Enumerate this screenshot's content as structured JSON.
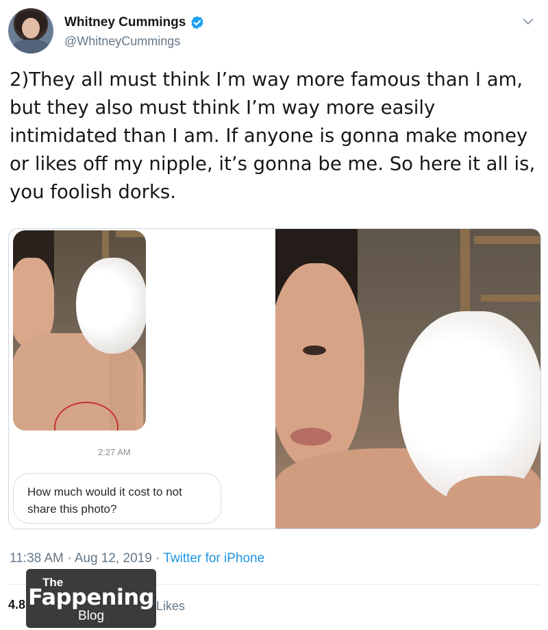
{
  "author": {
    "name": "Whitney Cummings",
    "handle": "@WhitneyCummings",
    "verified": true,
    "avatar_icon": "user-avatar",
    "menu_icon": "chevron-down-icon"
  },
  "tweet": {
    "text_lines": [
      "2)They all must think I’m way more famous than I am,",
      "but they also must think I’m way more easily",
      "intimidated than I am. If anyone is gonna make money",
      "or likes off my nipple, it’s gonna be me. So here it all is,",
      "you foolish dorks."
    ]
  },
  "media": {
    "message_screenshot": {
      "time": "2:27 AM",
      "message": "How much would it cost to not share this photo?"
    }
  },
  "footer": {
    "time": "11:38 AM",
    "date": "Aug 12, 2019",
    "separator": "·",
    "source": "Twitter for iPhone",
    "stats_prefix": "4.8",
    "likes_label": "Likes"
  },
  "watermark": {
    "line1": "The",
    "line2": "Fappening",
    "line3": "Blog"
  },
  "colors": {
    "link": "#1b95e0",
    "secondary": "#657786",
    "verified": "#1da1f2"
  }
}
